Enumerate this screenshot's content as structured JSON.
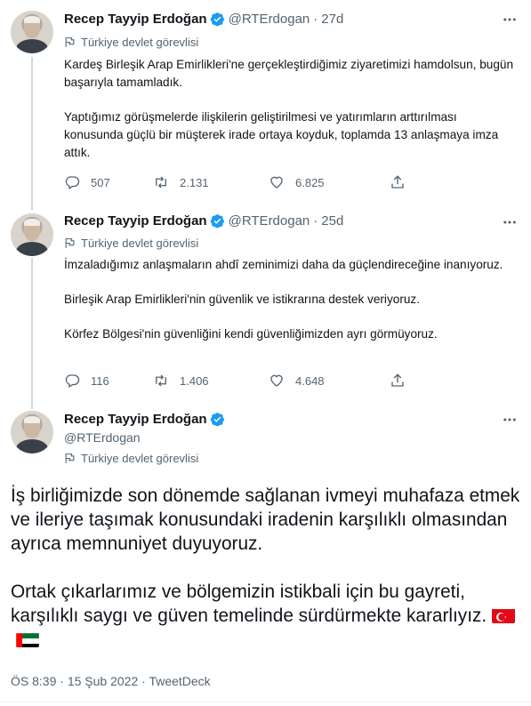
{
  "tweets": [
    {
      "name": "Recep Tayyip Erdoğan",
      "handle": "@RTErdogan",
      "time": "27d",
      "label": "Türkiye devlet görevlisi",
      "paragraphs": [
        "Kardeş Birleşik Arap Emirlikleri'ne gerçekleştirdiğimiz ziyaretimizi hamdolsun, bugün başarıyla tamamladık.",
        "Yaptığımız görüşmelerde ilişkilerin geliştirilmesi ve yatırımların arttırılması konusunda güçlü bir müşterek irade ortaya koyduk, toplamda 13 anlaşmaya imza attık."
      ],
      "replies": "507",
      "retweets": "2.131",
      "likes": "6.825"
    },
    {
      "name": "Recep Tayyip Erdoğan",
      "handle": "@RTErdogan",
      "time": "25d",
      "label": "Türkiye devlet görevlisi",
      "paragraphs": [
        "İmzaladığımız anlaşmaların ahdî zeminimizi daha da güçlendireceğine inanıyoruz.",
        "Birleşik Arap Emirlikleri'nin güvenlik ve istikrarına destek veriyoruz.",
        "Körfez Bölgesi'nin güvenliğini kendi güvenliğimizden ayrı görmüyoruz."
      ],
      "replies": "116",
      "retweets": "1.406",
      "likes": "4.648"
    }
  ],
  "main_tweet": {
    "name": "Recep Tayyip Erdoğan",
    "handle": "@RTErdogan",
    "label": "Türkiye devlet görevlisi",
    "paragraph1": "İş birliğimizde son dönemde sağlanan ivmeyi muhafaza etmek ve ileriye taşımak konusundaki iradenin karşılıklı olmasından ayrıca memnuniyet duyuyoruz.",
    "paragraph2": "Ortak çıkarlarımız ve bölgemizin istikbali için bu gayreti, karşılıklı saygı ve güven temelinde sürdürmekte kararlıyız.",
    "flags": [
      "turkey-flag",
      "uae-flag"
    ],
    "time": "ÖS 8:39",
    "date": "15 Şub 2022",
    "source": "TweetDeck",
    "separator": "·"
  },
  "colors": {
    "text": "#0f1419",
    "secondary": "#536471",
    "verified": "#1d9bf0",
    "thread_line": "#cfd9de"
  }
}
